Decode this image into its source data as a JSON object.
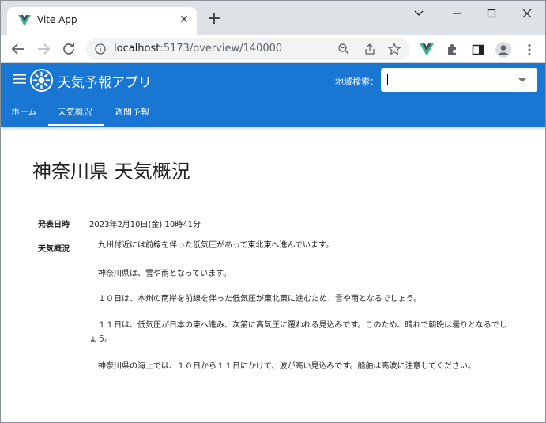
{
  "browser": {
    "tab_title": "Vite App",
    "url_host": "localhost",
    "url_rest": ":5173/overview/140000"
  },
  "appbar": {
    "title": "天気予報アプリ",
    "search_label": "地域検索：",
    "search_value": ""
  },
  "nav": {
    "tabs": [
      {
        "label": "ホーム"
      },
      {
        "label": "天気概況"
      },
      {
        "label": "週間予報"
      }
    ],
    "active_index": 1
  },
  "overview": {
    "page_title": "神奈川県 天気概況",
    "published_label": "発表日時",
    "published_value": "2023年2月10日(金) 10時41分",
    "summary_label": "天気概況",
    "paragraphs": [
      "九州付近には前線を伴った低気圧があって東北東へ進んでいます。",
      "神奈川県は、雪や雨となっています。",
      "１０日は、本州の南岸を前線を伴った低気圧が東北東に進むため、雪や雨となるでしょう。",
      "１１日は、低気圧が日本の東へ進み、次第に高気圧に覆われる見込みです。このため、晴れで朝晩は曇りとなるでしょう。",
      "神奈川県の海上では、１０日から１１日にかけて、波が高い見込みです。船舶は高波に注意してください。"
    ]
  },
  "colors": {
    "appbar": "#1976d2",
    "tabstrip": "#dee1e6",
    "vue_green": "#41b883",
    "vue_dark": "#34495e"
  }
}
